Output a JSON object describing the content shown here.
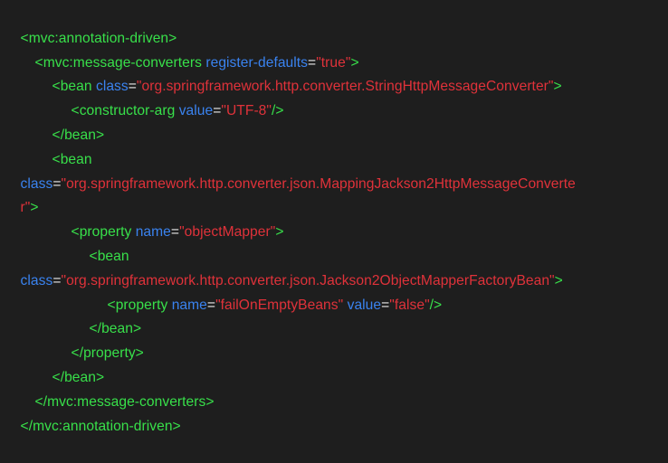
{
  "colors": {
    "background": "#1e1e1e",
    "tag": "#38e04a",
    "attribute": "#3a83f0",
    "string": "#e0323a",
    "punctuation": "#e8e8e8"
  },
  "code_lines": [
    [
      {
        "t": "tag",
        "v": "<mvc:annotation-driven>"
      }
    ],
    [
      {
        "t": "tag",
        "v": "<mvc:message-converters "
      },
      {
        "t": "attr",
        "v": "register-defaults"
      },
      {
        "t": "eq",
        "v": "="
      },
      {
        "t": "str",
        "v": "\"true\""
      },
      {
        "t": "tag",
        "v": ">"
      }
    ],
    [
      {
        "t": "tag",
        "v": "<bean "
      },
      {
        "t": "attr",
        "v": "class"
      },
      {
        "t": "eq",
        "v": "="
      },
      {
        "t": "str",
        "v": "\"org.springframework.http.converter.StringHttpMessageConverter\""
      },
      {
        "t": "tag",
        "v": ">"
      }
    ],
    [
      {
        "t": "tag",
        "v": "<constructor-arg "
      },
      {
        "t": "attr",
        "v": "value"
      },
      {
        "t": "eq",
        "v": "="
      },
      {
        "t": "str",
        "v": "\"UTF-8\""
      },
      {
        "t": "tag",
        "v": "/>"
      }
    ],
    [
      {
        "t": "tag",
        "v": "</bean>"
      }
    ],
    [
      {
        "t": "tag",
        "v": "<bean"
      }
    ],
    [
      {
        "t": "attr",
        "v": "class"
      },
      {
        "t": "eq",
        "v": "="
      },
      {
        "t": "str",
        "v": "\"org.springframework.http.converter.json.MappingJackson2HttpMessageConverte"
      }
    ],
    [
      {
        "t": "str",
        "v": "r\""
      },
      {
        "t": "tag",
        "v": ">"
      }
    ],
    [
      {
        "t": "tag",
        "v": "<property "
      },
      {
        "t": "attr",
        "v": "name"
      },
      {
        "t": "eq",
        "v": "="
      },
      {
        "t": "str",
        "v": "\"objectMapper\""
      },
      {
        "t": "tag",
        "v": ">"
      }
    ],
    [
      {
        "t": "tag",
        "v": "<bean"
      }
    ],
    [
      {
        "t": "attr",
        "v": "class"
      },
      {
        "t": "eq",
        "v": "="
      },
      {
        "t": "str",
        "v": "\"org.springframework.http.converter.json.Jackson2ObjectMapperFactoryBean\""
      },
      {
        "t": "tag",
        "v": ">"
      }
    ],
    [
      {
        "t": "tag",
        "v": "<property "
      },
      {
        "t": "attr",
        "v": "name"
      },
      {
        "t": "eq",
        "v": "="
      },
      {
        "t": "str",
        "v": "\"failOnEmptyBeans\""
      },
      {
        "t": "eq",
        "v": " "
      },
      {
        "t": "attr",
        "v": "value"
      },
      {
        "t": "eq",
        "v": "="
      },
      {
        "t": "str",
        "v": "\"false\""
      },
      {
        "t": "tag",
        "v": "/>"
      }
    ],
    [
      {
        "t": "tag",
        "v": "</bean>"
      }
    ],
    [
      {
        "t": "tag",
        "v": "</property>"
      }
    ],
    [
      {
        "t": "tag",
        "v": "</bean>"
      }
    ],
    [
      {
        "t": "tag",
        "v": "</mvc:message-converters>"
      }
    ],
    [
      {
        "t": "tag",
        "v": "</mvc:annotation-driven>"
      }
    ]
  ]
}
